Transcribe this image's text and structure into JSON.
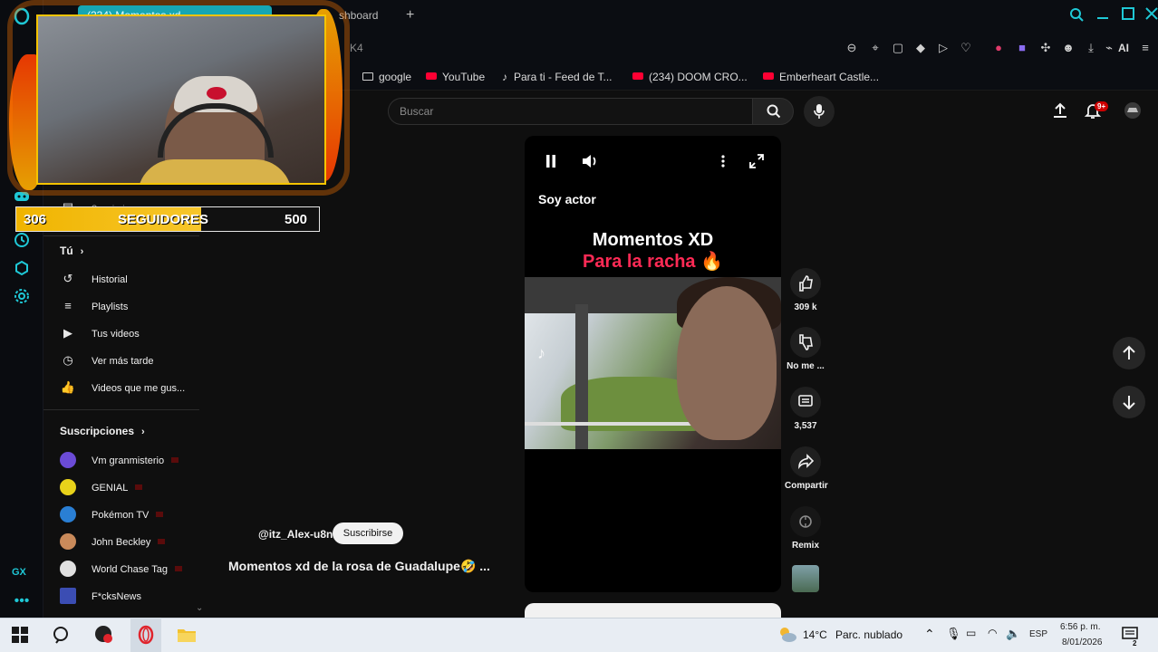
{
  "browser": {
    "active_tab_label": "(234) Momentos xd",
    "second_tab_label": "shboard",
    "address_fragment": "K4",
    "ai_label": "AI",
    "bookmarks": [
      {
        "label": "google",
        "kind": "folder"
      },
      {
        "label": "YouTube",
        "kind": "youtube"
      },
      {
        "label": "Para ti - Feed de T...",
        "kind": "tiktok"
      },
      {
        "label": "(234) DOOM CRO...",
        "kind": "youtube"
      },
      {
        "label": "Emberheart Castle...",
        "kind": "youtube"
      }
    ],
    "gx_label": "GX",
    "accent": "#1fc8d6"
  },
  "header": {
    "search_placeholder": "Buscar",
    "notifications_badge": "9+"
  },
  "stream_overlay": {
    "followers_current": "306",
    "followers_label": "SEGUIDORES",
    "followers_goal": "500",
    "progress_fraction": 0.612
  },
  "sidebar": {
    "partial_item": "Suscripciones",
    "you_heading": "Tú",
    "you_items": [
      {
        "label": "Historial",
        "icon": "history-icon"
      },
      {
        "label": "Playlists",
        "icon": "playlists-icon"
      },
      {
        "label": "Tus videos",
        "icon": "your-videos-icon"
      },
      {
        "label": "Ver más tarde",
        "icon": "watch-later-icon"
      },
      {
        "label": "Videos que me gus...",
        "icon": "liked-videos-icon"
      }
    ],
    "subscriptions_heading": "Suscripciones",
    "subscriptions": [
      {
        "label": "Vm granmisterio",
        "color": "#6b4bd6"
      },
      {
        "label": "GENIAL",
        "color": "#e8d21a"
      },
      {
        "label": "Pokémon TV",
        "color": "#2a7fd4"
      },
      {
        "label": "John Beckley",
        "color": "#c98a5a"
      },
      {
        "label": "World Chase Tag",
        "color": "#e0e0e0"
      },
      {
        "label": "F*cksNews",
        "color": "#3b4db3"
      }
    ]
  },
  "short": {
    "title": "Soy actor",
    "caption_line1": "Momentos XD",
    "caption_line2": "Para la racha 🔥",
    "channel": "@itz_Alex-u8n",
    "subscribe_label": "Suscribirse",
    "video_title": "Momentos xd de la rosa de Guadalupe🤣 ...",
    "actions": {
      "like_count": "309 k",
      "dislike_label": "No me ...",
      "comments_count": "3,537",
      "share_label": "Compartir",
      "remix_label": "Remix"
    }
  },
  "taskbar": {
    "weather_temp": "14°C",
    "weather_desc": "Parc. nublado",
    "language": "ESP",
    "time": "6:56 p. m.",
    "date": "8/01/2026",
    "notifications_count": "2"
  }
}
